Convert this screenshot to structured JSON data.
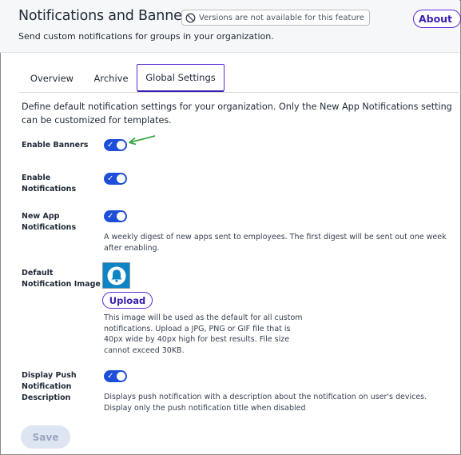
{
  "header": {
    "title": "Notifications and Banners",
    "version_notice": "Versions are not available for this feature",
    "version_icon": "block-icon",
    "about_label": "About",
    "subtitle": "Send custom notifications for groups in your organization."
  },
  "tabs": [
    {
      "label": "Overview",
      "active": false
    },
    {
      "label": "Archive",
      "active": false
    },
    {
      "label": "Global Settings",
      "active": true
    }
  ],
  "intro": "Define default notification settings for your organization. Only the New App Notifications setting can be customized for templates.",
  "settings": {
    "enable_banners": {
      "label": "Enable Banners",
      "enabled": true
    },
    "enable_notifications": {
      "label": "Enable\nNotifications",
      "enabled": true
    },
    "new_app_notifications": {
      "label": "New App\nNotifications",
      "enabled": true,
      "help": "A weekly digest of new apps sent to employees. The first digest will be sent out one week after enabling."
    },
    "default_notification_image": {
      "label": "Default\nNotification Image",
      "upload_label": "Upload",
      "help": "This image will be used as the default for all custom\nnotifications. Upload a JPG, PNG or GIF file that is\n40px wide by 40px high for best results. File size\ncannot exceed 30KB."
    },
    "display_push_description": {
      "label": "Display Push\nNotification\nDescription",
      "enabled": true,
      "help": "Displays push notification with a description about the notification on user's devices. Display only the push notification title when disabled"
    }
  },
  "save_label": "Save",
  "colors": {
    "accent": "#5b2bd6",
    "toggle_on": "#1d4ed8",
    "arrow": "#3aa845",
    "image_bg": "#0e84c4"
  }
}
